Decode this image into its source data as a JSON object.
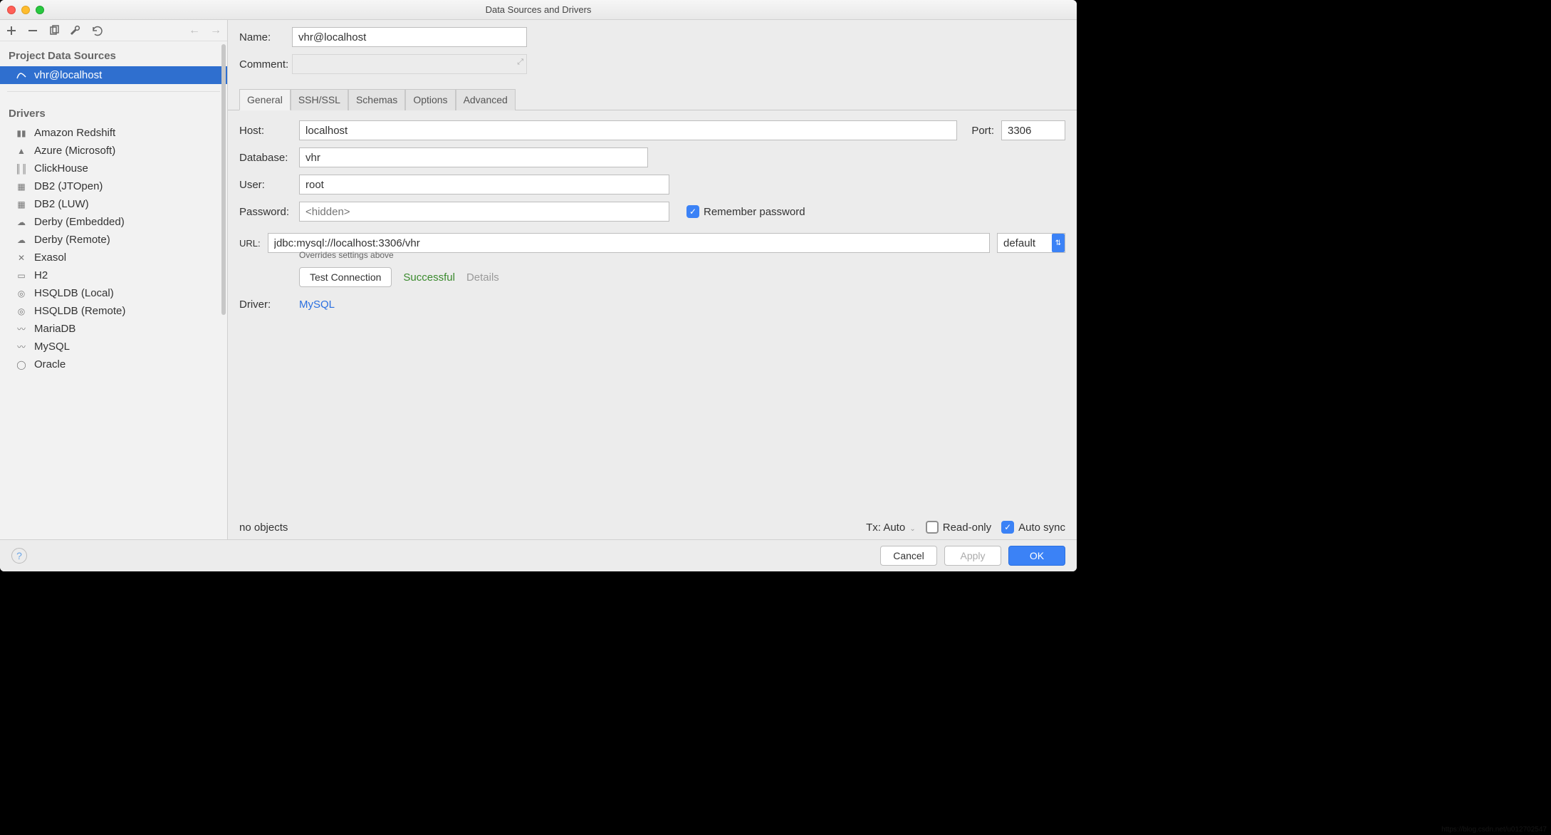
{
  "title": "Data Sources and Drivers",
  "sidebar": {
    "section_sources": "Project Data Sources",
    "source_selected": "vhr@localhost",
    "section_drivers": "Drivers",
    "drivers": [
      "Amazon Redshift",
      "Azure (Microsoft)",
      "ClickHouse",
      "DB2 (JTOpen)",
      "DB2 (LUW)",
      "Derby (Embedded)",
      "Derby (Remote)",
      "Exasol",
      "H2",
      "HSQLDB (Local)",
      "HSQLDB (Remote)",
      "MariaDB",
      "MySQL",
      "Oracle"
    ]
  },
  "form": {
    "name_label": "Name:",
    "name_value": "vhr@localhost",
    "comment_label": "Comment:"
  },
  "tabs": {
    "general": "General",
    "sshssl": "SSH/SSL",
    "schemas": "Schemas",
    "options": "Options",
    "advanced": "Advanced"
  },
  "general": {
    "host_label": "Host:",
    "host_value": "localhost",
    "port_label": "Port:",
    "port_value": "3306",
    "database_label": "Database:",
    "database_value": "vhr",
    "user_label": "User:",
    "user_value": "root",
    "password_label": "Password:",
    "password_placeholder": "<hidden>",
    "remember_password": "Remember password",
    "url_label": "URL:",
    "url_value": "jdbc:mysql://localhost:3306/vhr",
    "url_mode": "default",
    "url_hint": "Overrides settings above",
    "test_connection": "Test Connection",
    "test_status": "Successful",
    "test_details": "Details",
    "driver_label": "Driver:",
    "driver_value": "MySQL"
  },
  "meta": {
    "no_objects": "no objects",
    "tx_label": "Tx:",
    "tx_value": "Auto",
    "read_only": "Read-only",
    "auto_sync": "Auto sync"
  },
  "footer": {
    "cancel": "Cancel",
    "apply": "Apply",
    "ok": "OK"
  }
}
